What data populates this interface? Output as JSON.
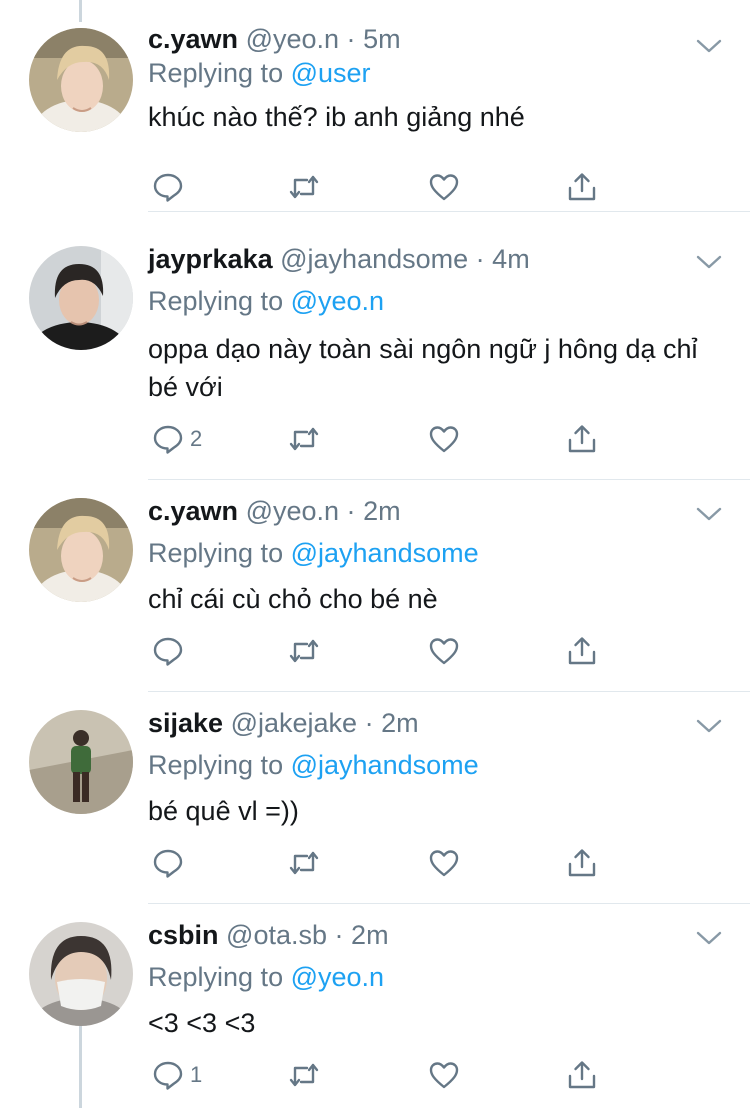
{
  "colors": {
    "accent": "#1da1f2",
    "muted": "#657786",
    "text": "#14171a",
    "thread_line": "#ccd6dd"
  },
  "tweets": [
    {
      "name": "c.yawn",
      "handle": "@yeo.n",
      "sep": "·",
      "time": "5m",
      "replying_label": "Replying to",
      "replying_to": "@user",
      "text": "khúc nào thế? ib anh giảng nhé",
      "reply_count": "",
      "avatar": "blonde-person-avatar"
    },
    {
      "name": "jayprkaka",
      "handle": "@jayhandsome",
      "sep": "·",
      "time": "4m",
      "replying_label": "Replying to",
      "replying_to": "@yeo.n",
      "text": "oppa dạo này toàn sài ngôn ngữ j hông dạ chỉ bé với",
      "reply_count": "2",
      "avatar": "dark-hair-person-avatar"
    },
    {
      "name": "c.yawn",
      "handle": "@yeo.n",
      "sep": "·",
      "time": "2m",
      "replying_label": "Replying to",
      "replying_to": "@jayhandsome",
      "text": "chỉ cái cù chỏ cho bé nè",
      "reply_count": "",
      "avatar": "blonde-person-avatar"
    },
    {
      "name": "sijake",
      "handle": "@jakejake",
      "sep": "·",
      "time": "2m",
      "replying_label": "Replying to",
      "replying_to": "@jayhandsome",
      "text": "bé quê vl =))",
      "reply_count": "",
      "avatar": "standing-person-avatar"
    },
    {
      "name": "csbin",
      "handle": "@ota.sb",
      "sep": "·",
      "time": "2m",
      "replying_label": "Replying to",
      "replying_to": "@yeo.n",
      "text": "<3 <3 <3",
      "reply_count": "1",
      "avatar": "masked-person-avatar"
    }
  ]
}
